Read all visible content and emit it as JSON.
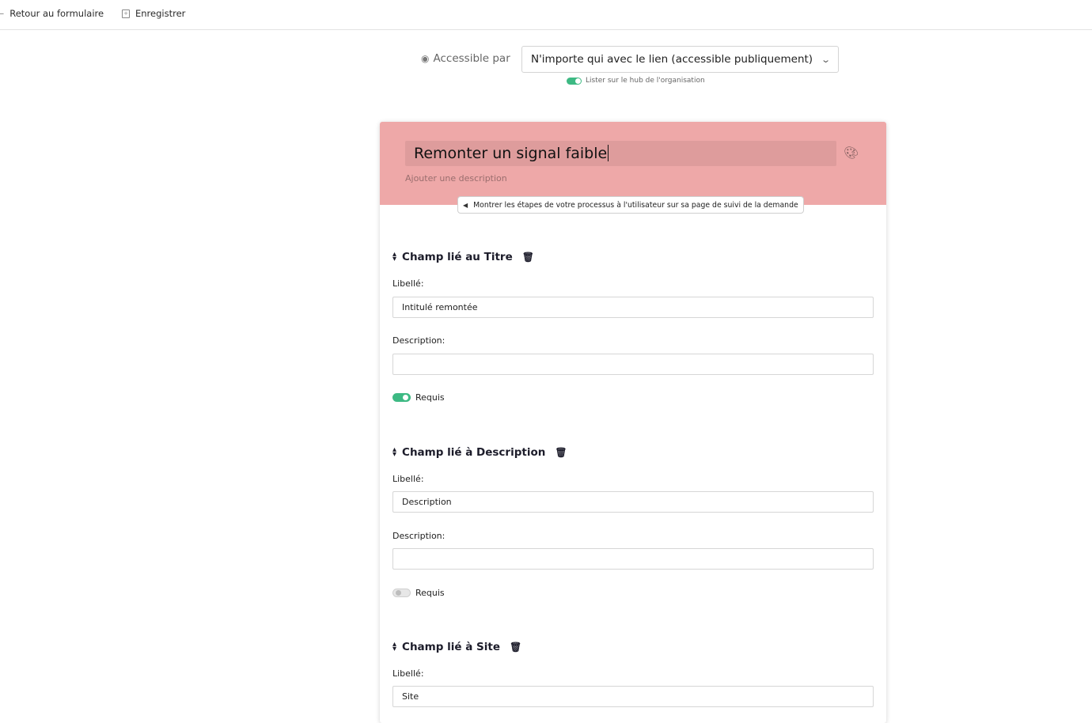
{
  "topbar": {
    "back_label": "Retour au formulaire",
    "back_icon": "arrow-left-icon",
    "save_label": "Enregistrer",
    "save_icon": "save-icon"
  },
  "access": {
    "label": "Accessible par",
    "icon": "eye-icon",
    "selected": "N'importe qui avec le lien (accessible publiquement)",
    "hub_label": "Lister sur le hub de l'organisation",
    "hub_enabled": true
  },
  "header": {
    "title": "Remonter un signal faible",
    "description_placeholder": "Ajouter une description",
    "steps_button": "Montrer les étapes de votre processus à l'utilisateur sur sa page de suivi de la demande",
    "color": "#eea8a8"
  },
  "fields": [
    {
      "title": "Champ lié au Titre",
      "label_caption": "Libellé:",
      "label_value": "Intitulé remontée",
      "description_caption": "Description:",
      "description_value": "",
      "required_label": "Requis",
      "required": true
    },
    {
      "title": "Champ lié à Description",
      "label_caption": "Libellé:",
      "label_value": "Description",
      "description_caption": "Description:",
      "description_value": "",
      "required_label": "Requis",
      "required": false
    },
    {
      "title": "Champ lié à Site",
      "label_caption": "Libellé:",
      "label_value": "Site"
    }
  ],
  "colors": {
    "accent_toggle": "#3db983",
    "header_bg": "#eea8a8",
    "title_bg": "#de9c9c"
  }
}
